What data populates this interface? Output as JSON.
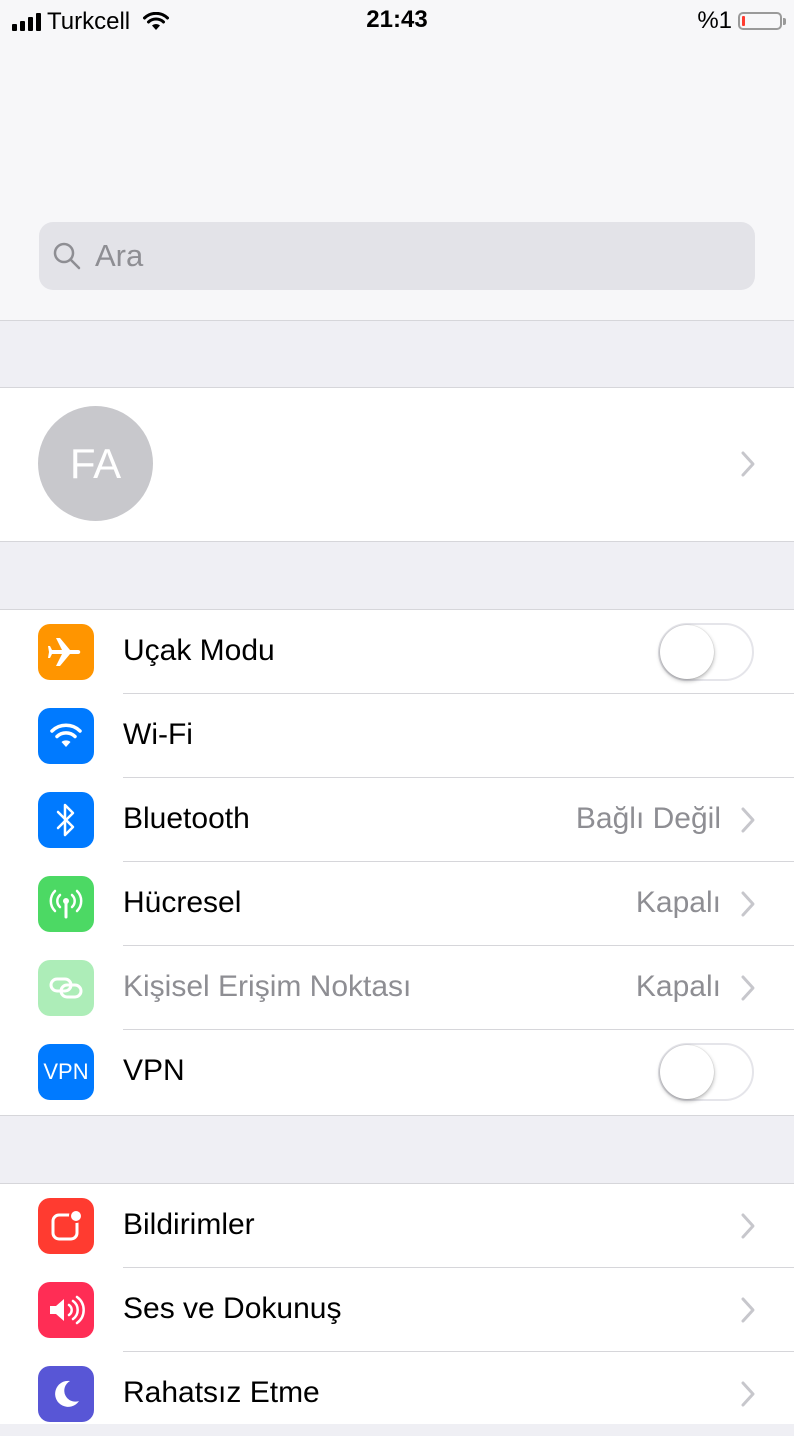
{
  "status_bar": {
    "carrier": "Turkcell",
    "time": "21:43",
    "battery_percent": "%1",
    "battery_level": 0.01
  },
  "search": {
    "placeholder": "Ara"
  },
  "profile": {
    "initials": "FA"
  },
  "connectivity": [
    {
      "label": "Uçak Modu",
      "icon": "airplane-icon",
      "icon_color": "#ff9500",
      "toggle": false
    },
    {
      "label": "Wi-Fi",
      "icon": "wifi-icon",
      "icon_color": "#007aff"
    },
    {
      "label": "Bluetooth",
      "icon": "bluetooth-icon",
      "icon_color": "#007aff",
      "value": "Bağlı Değil"
    },
    {
      "label": "Hücresel",
      "icon": "cellular-icon",
      "icon_color": "#4cd964",
      "value": "Kapalı"
    },
    {
      "label": "Kişisel Erişim Noktası",
      "icon": "hotspot-icon",
      "icon_color": "#4cd964",
      "value": "Kapalı",
      "disabled": true
    },
    {
      "label": "VPN",
      "icon_text": "VPN",
      "icon_color": "#007aff",
      "toggle": false
    }
  ],
  "general": [
    {
      "label": "Bildirimler",
      "icon": "notifications-icon",
      "icon_color": "#ff3b30"
    },
    {
      "label": "Ses ve Dokunuş",
      "icon": "speaker-icon",
      "icon_color": "#ff2d55"
    },
    {
      "label": "Rahatsız Etme",
      "icon": "moon-icon",
      "icon_color": "#5856d6"
    }
  ]
}
